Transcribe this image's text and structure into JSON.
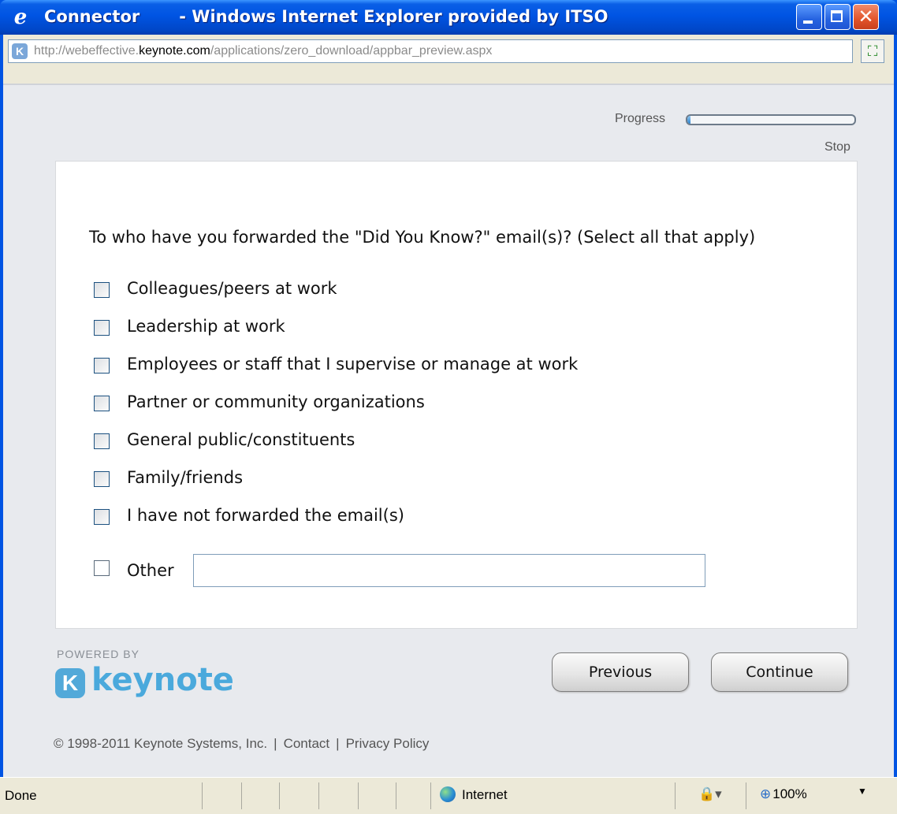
{
  "window": {
    "title_app": "Connector",
    "title_suffix": "- Windows Internet Explorer provided by ITSO",
    "address": {
      "prefix": "http://webeffective.",
      "host": "keynote.com",
      "path": "/applications/zero_download/appbar_preview.aspx"
    }
  },
  "survey": {
    "progress_label": "Progress",
    "progress_value": 0.02,
    "stop_label": "Stop",
    "question": "To who have you forwarded the \"Did You Know?\" email(s)? (Select all that apply)",
    "options": [
      "Colleagues/peers at work",
      "Leadership at work",
      "Employees or staff that I supervise or manage at work",
      "Partner or community organizations",
      "General public/constituents",
      "Family/friends",
      "I have not forwarded the email(s)",
      "Other"
    ],
    "other_value": ""
  },
  "branding": {
    "powered_by": "POWERED BY",
    "logo_text": "keynote",
    "brand_color": "#4aa9dc"
  },
  "buttons": {
    "previous": "Previous",
    "continue": "Continue"
  },
  "footer": {
    "copyright": "© 1998-2011 Keynote Systems, Inc.",
    "contact": "Contact",
    "privacy": "Privacy Policy",
    "separator": "|"
  },
  "statusbar": {
    "status": "Done",
    "zone": "Internet",
    "zoom": "100%"
  }
}
